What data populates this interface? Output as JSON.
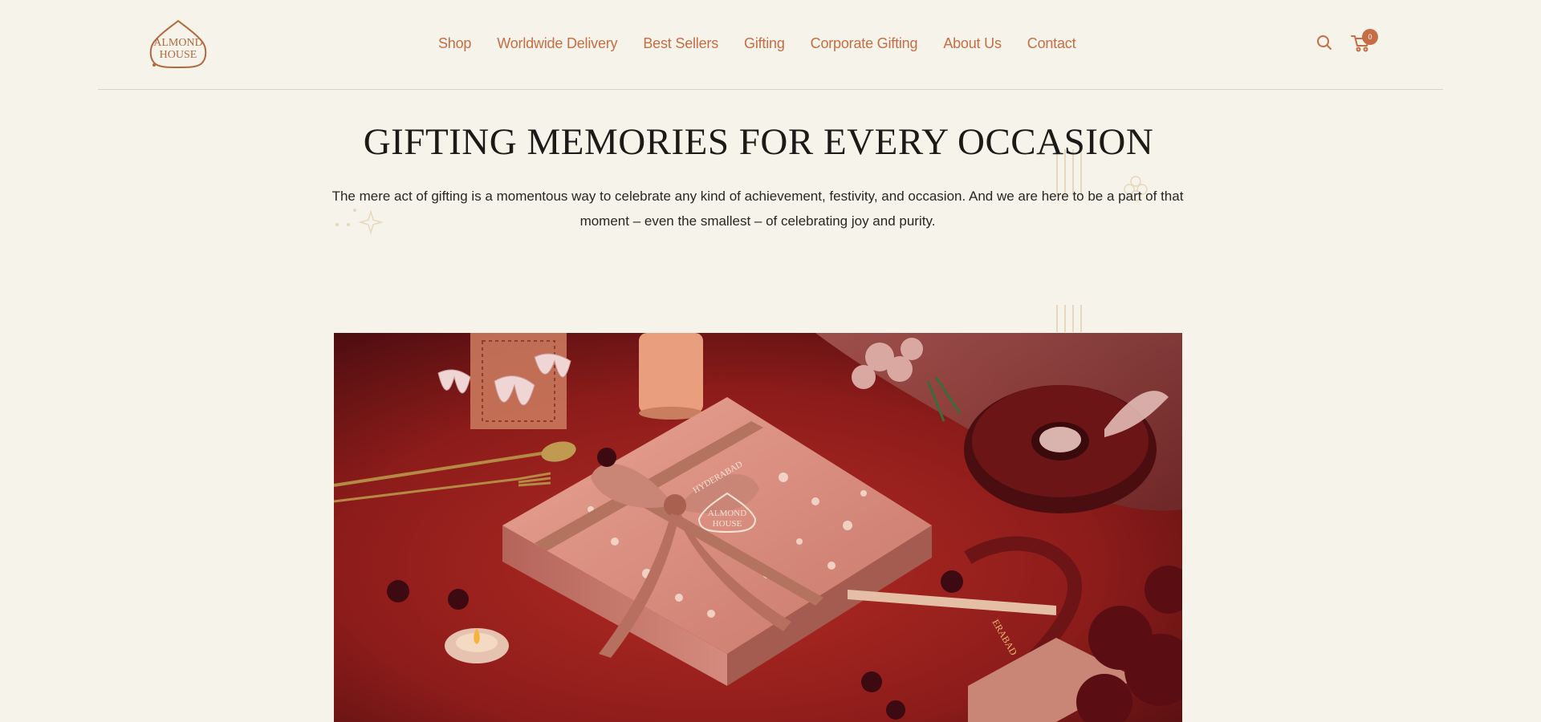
{
  "brand": {
    "logo_line1": "ALMOND",
    "logo_line2": "HOUSE",
    "accent_color": "#c56e45",
    "background_color": "#f5f3ea"
  },
  "nav": {
    "items": [
      {
        "label": "Shop"
      },
      {
        "label": "Worldwide Delivery"
      },
      {
        "label": "Best Sellers"
      },
      {
        "label": "Gifting"
      },
      {
        "label": "Corporate Gifting"
      },
      {
        "label": "About Us"
      },
      {
        "label": "Contact"
      }
    ]
  },
  "header_actions": {
    "search_icon": "search-icon",
    "cart_icon": "cart-icon",
    "cart_count": "0"
  },
  "hero": {
    "title": "GIFTING MEMORIES FOR EVERY OCCASION",
    "description": "The mere act of gifting is a momentous way to celebrate any kind of achievement, festivity, and occasion. And we are here to be a part of that moment – even the smallest – of celebrating joy and purity."
  },
  "feature_image": {
    "box_logo_line1": "ALMOND",
    "box_logo_line2": "HOUSE",
    "box_city": "HYDERABAD",
    "ribbon_text": "ERABAD"
  }
}
